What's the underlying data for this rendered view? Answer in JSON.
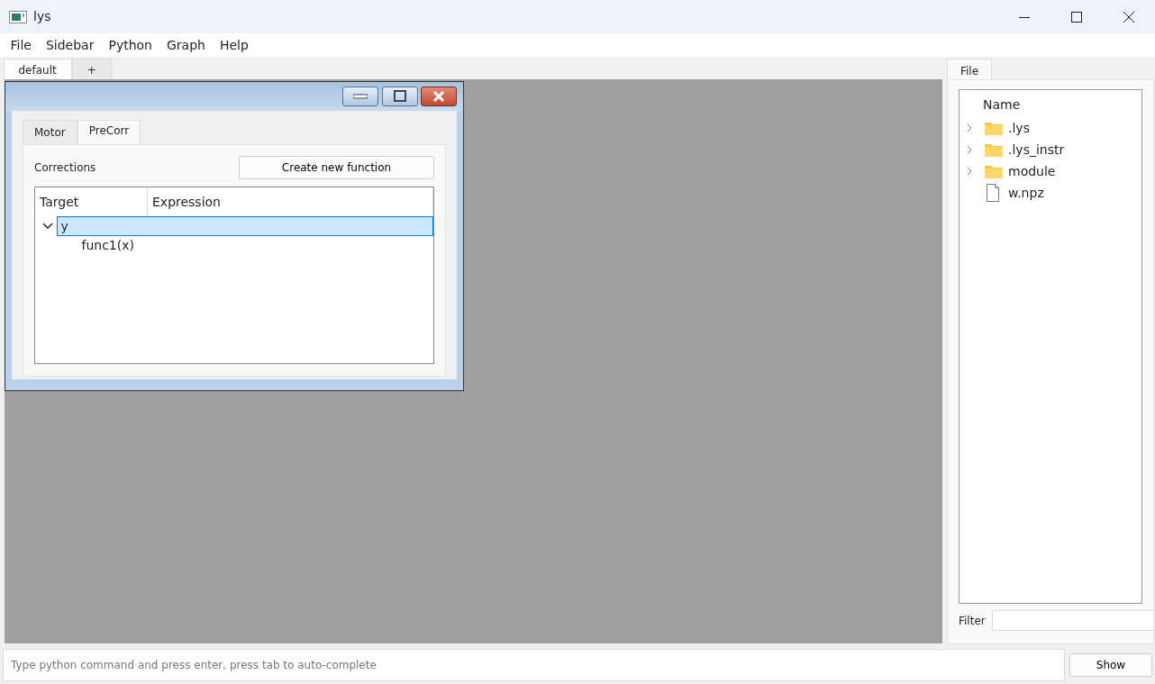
{
  "window": {
    "title": "lys"
  },
  "menu": [
    "File",
    "Sidebar",
    "Python",
    "Graph",
    "Help"
  ],
  "workspace_tabs": [
    {
      "label": "default",
      "selected": true
    },
    {
      "label": "+",
      "selected": false
    }
  ],
  "subwindow": {
    "tabs": [
      {
        "label": "Motor",
        "selected": false
      },
      {
        "label": "PreCorr",
        "selected": true
      }
    ],
    "corrections_label": "Corrections",
    "create_button": "Create new function",
    "columns": [
      "Target",
      "Expression"
    ],
    "rows": [
      {
        "target": "y",
        "expanded": true,
        "selected": true,
        "children": [
          {
            "target": "func1(x)",
            "selected": false
          }
        ]
      }
    ]
  },
  "sidebar": {
    "tabs": [
      {
        "label": "File",
        "selected": true
      }
    ],
    "column": "Name",
    "files": [
      {
        "name": ".lys",
        "kind": "folder"
      },
      {
        "name": ".lys_instr",
        "kind": "folder"
      },
      {
        "name": "module",
        "kind": "folder"
      },
      {
        "name": "w.npz",
        "kind": "file"
      }
    ],
    "filter_label": "Filter"
  },
  "command": {
    "placeholder": "Type python command and press enter, press tab to auto-complete",
    "button": "Show"
  }
}
